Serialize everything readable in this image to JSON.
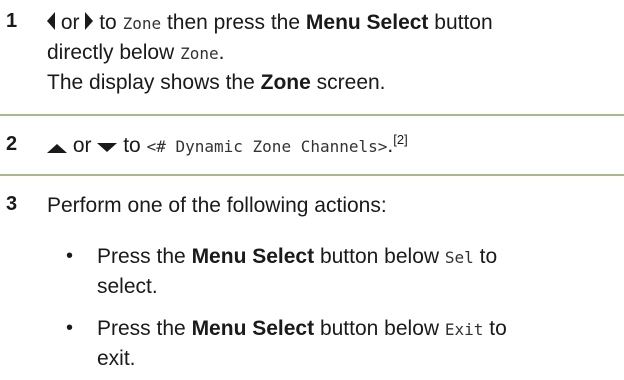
{
  "steps": [
    {
      "number": "1",
      "or_word": "or",
      "to_word": "to",
      "zone_code": "Zone",
      "mid_text": "then press the",
      "button_name": "Menu Select",
      "button_word": "button",
      "line2_text": "directly below",
      "period": ".",
      "result_prefix": "The display shows the",
      "result_screen": "Zone",
      "result_suffix": "screen."
    },
    {
      "number": "2",
      "or_word": "or",
      "to_word": "to",
      "channel_code": "<# Dynamic Zone Channels>",
      "period": ".",
      "footnote": "[2]"
    },
    {
      "number": "3",
      "intro": "Perform one of the following actions:",
      "actions": [
        {
          "bullet": "•",
          "prefix": "Press the",
          "button_name": "Menu Select",
          "mid": "button below",
          "code": "Sel",
          "suffix_line1": "to",
          "line2": "select."
        },
        {
          "bullet": "•",
          "prefix": "Press the",
          "button_name": "Menu Select",
          "mid": "button below",
          "code": "Exit",
          "suffix_line1": "to",
          "line2": "exit."
        }
      ]
    }
  ],
  "colors": {
    "divider": "#a8b98c",
    "text": "#1a1a1a"
  },
  "icons": {
    "left": "left-arrow-icon",
    "right": "right-arrow-icon",
    "up": "up-arrow-icon",
    "down": "down-arrow-icon"
  }
}
